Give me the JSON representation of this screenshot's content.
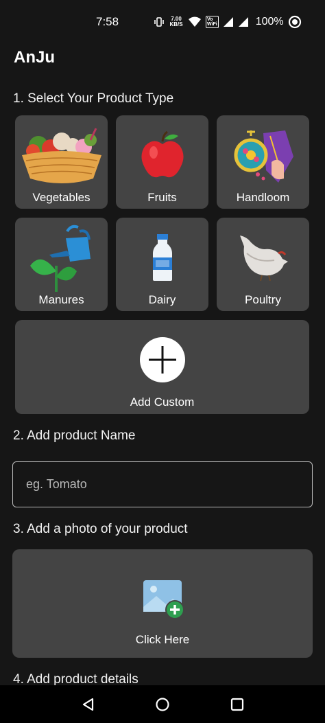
{
  "status_bar": {
    "time": "7:58",
    "net_speed_value": "7.00",
    "net_speed_unit": "KB/S",
    "wifi_tag_top": "Vo",
    "wifi_tag_bottom": "WiFi",
    "battery": "100%"
  },
  "app": {
    "title": "AnJu"
  },
  "sections": {
    "product_type": "1. Select Your Product Type",
    "product_name": "2. Add product Name",
    "photo": "3. Add a photo of your product",
    "details": "4. Add product details"
  },
  "product_types": [
    {
      "label": "Vegetables",
      "icon": "vegetables-basket-icon"
    },
    {
      "label": "Fruits",
      "icon": "apple-icon"
    },
    {
      "label": "Handloom",
      "icon": "embroidery-icon"
    },
    {
      "label": "Manures",
      "icon": "sprout-watering-can-icon"
    },
    {
      "label": "Dairy",
      "icon": "milk-bottle-icon"
    },
    {
      "label": "Poultry",
      "icon": "hen-icon"
    }
  ],
  "custom": {
    "label": "Add Custom",
    "icon": "plus-circle-icon"
  },
  "name_input": {
    "placeholder": "eg. Tomato",
    "value": ""
  },
  "photo_upload": {
    "label": "Click Here",
    "icon": "add-image-icon"
  },
  "colors": {
    "background": "#161616",
    "tile": "#444444",
    "accent_green": "#2e9e4f"
  }
}
